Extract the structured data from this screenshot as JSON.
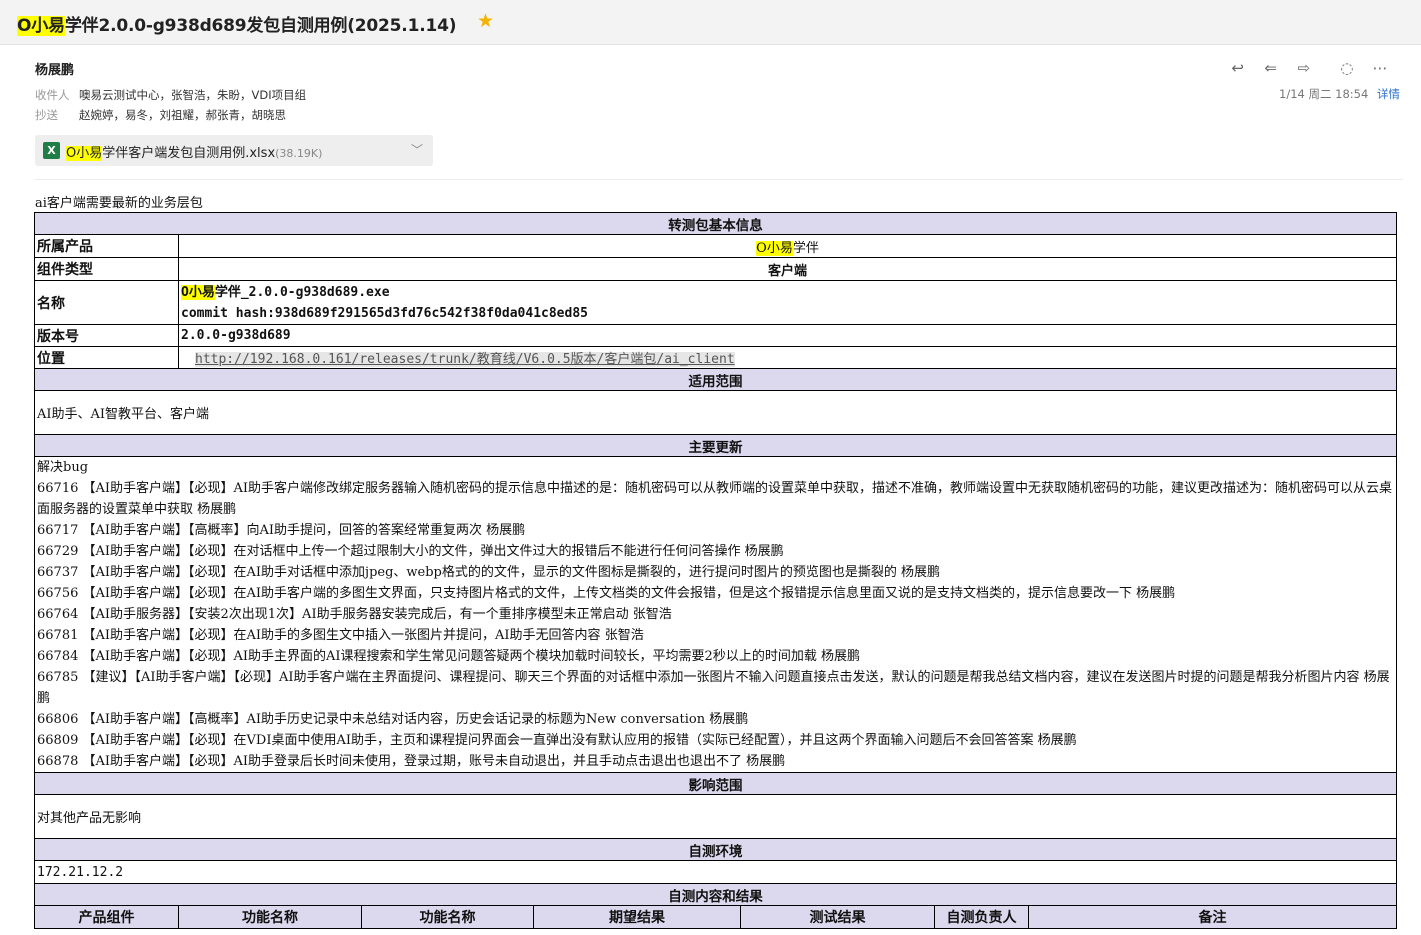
{
  "subject": {
    "prefix": "O小易",
    "rest": "学伴2.0.0-g938d689发包自测用例(2025.1.14)"
  },
  "sender": "杨展鹏",
  "to": {
    "label": "收件人",
    "value": "噢易云测试中心，张智浩，朱盼，VDI项目组"
  },
  "cc": {
    "label": "抄送",
    "value": "赵婉婷，易冬，刘祖耀，郝张青，胡晓思"
  },
  "time": "1/14 周二 18:54",
  "detail": "详情",
  "attachment": {
    "prefix": "O小易",
    "name": "学伴客户端发包自测用例.xlsx",
    "size": "(38.19K)"
  },
  "intro": "ai客户端需要最新的业务层包",
  "basic": {
    "header": "转测包基本信息",
    "product_label": "所属产品",
    "product_prefix": "O小易",
    "product_rest": "学伴",
    "type_label": "组件类型",
    "type_value": "客户端",
    "name_label": "名称",
    "name_prefix": "O小易",
    "name_rest": "学伴_2.0.0-g938d689.exe",
    "commit": "commit hash:938d689f291565d3fd76c542f38f0da041c8ed85",
    "version_label": "版本号",
    "version_value": "2.0.0-g938d689",
    "location_label": "位置",
    "location_url": "http://192.168.0.161/releases/trunk/教育线/V6.0.5版本/客户端包/ai_client"
  },
  "scope": {
    "header": "适用范围",
    "value": "AI助手、AI智教平台、客户端"
  },
  "updates": {
    "header": "主要更新",
    "lines": [
      "解决bug",
      "66716 【AI助手客户端】【必现】AI助手客户端修改绑定服务器输入随机密码的提示信息中描述的是：随机密码可以从教师端的设置菜单中获取，描述不准确，教师端设置中无获取随机密码的功能，建议更改描述为：随机密码可以从云桌面服务器的设置菜单中获取 杨展鹏",
      "66717 【AI助手客户端】【高概率】向AI助手提问，回答的答案经常重复两次 杨展鹏",
      "66729 【AI助手客户端】【必现】在对话框中上传一个超过限制大小的文件，弹出文件过大的报错后不能进行任何问答操作 杨展鹏",
      "66737 【AI助手客户端】【必现】在AI助手对话框中添加jpeg、webp格式的的文件，显示的文件图标是撕裂的，进行提问时图片的预览图也是撕裂的 杨展鹏",
      "66756 【AI助手客户端】【必现】在AI助手客户端的多图生文界面，只支持图片格式的文件，上传文档类的文件会报错，但是这个报错提示信息里面又说的是支持文档类的，提示信息要改一下 杨展鹏",
      "66764 【AI助手服务器】【安装2次出现1次】AI助手服务器安装完成后，有一个重排序模型未正常启动 张智浩",
      "66781 【AI助手客户端】【必现】在AI助手的多图生文中插入一张图片并提问，AI助手无回答内容 张智浩",
      "66784 【AI助手客户端】【必现】AI助手主界面的AI课程搜索和学生常见问题答疑两个模块加载时间较长，平均需要2秒以上的时间加载 杨展鹏",
      "66785 【建议】【AI助手客户端】【必现】AI助手客户端在主界面提问、课程提问、聊天三个界面的对话框中添加一张图片不输入问题直接点击发送，默认的问题是帮我总结文档内容，建议在发送图片时提的问题是帮我分析图片内容 杨展鹏",
      "66806 【AI助手客户端】【高概率】AI助手历史记录中未总结对话内容，历史会话记录的标题为New conversation 杨展鹏",
      "66809 【AI助手客户端】【必现】在VDI桌面中使用AI助手，主页和课程提问界面会一直弹出没有默认应用的报错（实际已经配置），并且这两个界面输入问题后不会回答答案 杨展鹏",
      "66878 【AI助手客户端】【必现】AI助手登录后长时间未使用，登录过期，账号未自动退出，并且手动点击退出也退出不了 杨展鹏"
    ]
  },
  "impact": {
    "header": "影响范围",
    "value": "对其他产品无影响"
  },
  "env": {
    "header": "自测环境",
    "value": "172.21.12.2"
  },
  "results": {
    "header": "自测内容和结果",
    "columns": [
      "产品组件",
      "功能名称",
      "功能名称",
      "期望结果",
      "测试结果",
      "自测负责人",
      "备注"
    ]
  }
}
